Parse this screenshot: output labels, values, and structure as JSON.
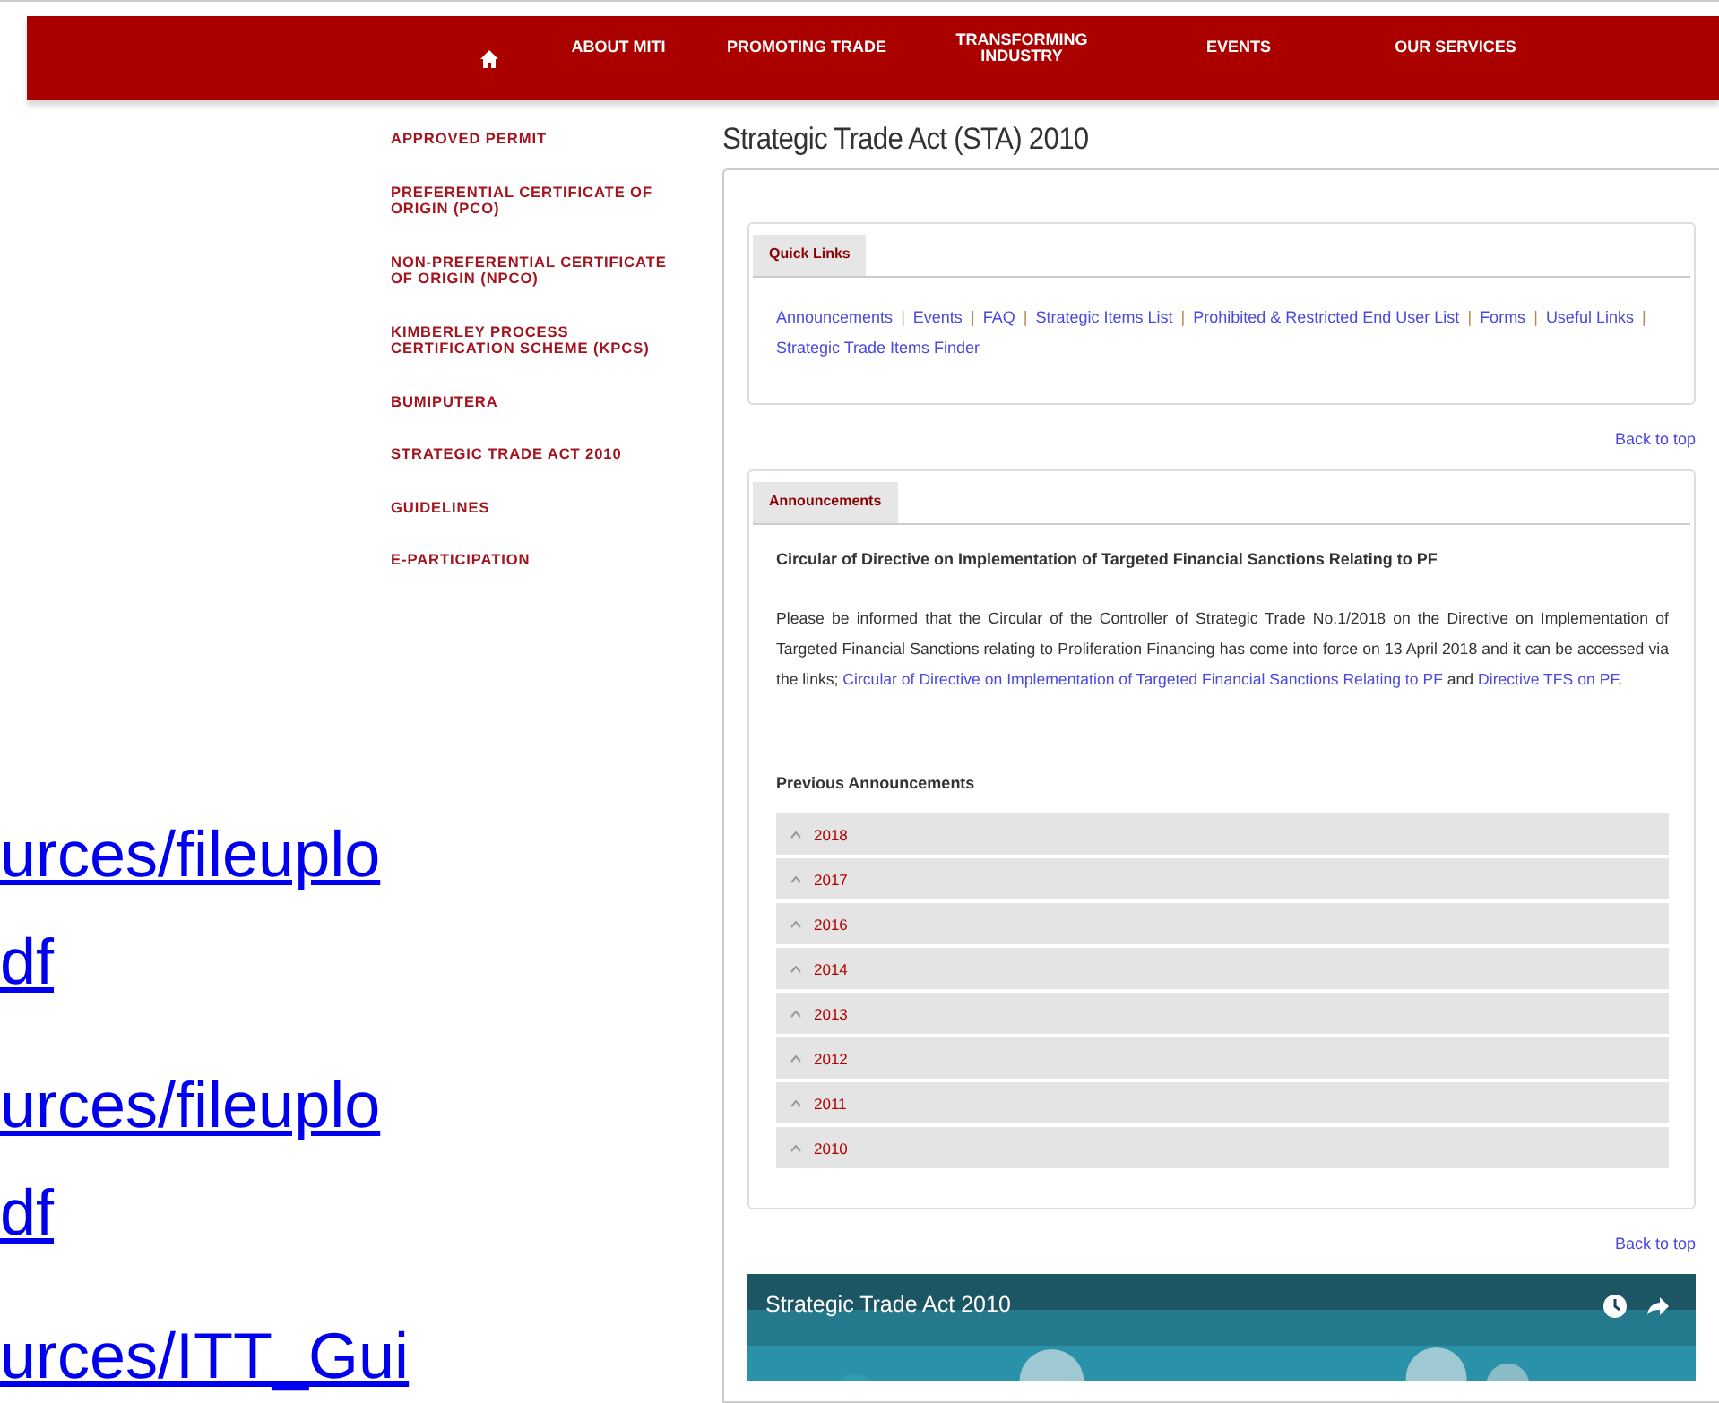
{
  "nav": {
    "items": [
      "ABOUT MITI",
      "PROMOTING TRADE",
      "TRANSFORMING INDUSTRY",
      "EVENTS",
      "OUR SERVICES"
    ]
  },
  "sidebar": {
    "items": [
      "APPROVED PERMIT",
      "PREFERENTIAL CERTIFICATE OF ORIGIN (PCO)",
      "NON-PREFERENTIAL CERTIFICATE OF ORIGIN (NPCO)",
      "KIMBERLEY PROCESS CERTIFICATION SCHEME (KPCS)",
      "BUMIPUTERA",
      "STRATEGIC TRADE ACT 2010",
      "GUIDELINES",
      "E-PARTICIPATION"
    ]
  },
  "page_title": "Strategic Trade Act (STA) 2010",
  "quick_links": {
    "tab": "Quick Links",
    "separator": "|",
    "links": [
      "Announcements",
      "Events",
      "FAQ",
      "Strategic Items List",
      "Prohibited & Restricted End User List",
      "Forms",
      "Useful Links",
      "Strategic Trade Items Finder"
    ],
    "back_link": "Back to top"
  },
  "announcements": {
    "tab": "Announcements",
    "heading": "Circular of Directive on Implementation of Targeted Financial Sanctions Relating to PF",
    "body": [
      {
        "kind": "text",
        "text": "Please be informed that the Circular of the Controller of Strategic Trade No.1/2018 on the Directive on Implementation of Targeted Financial Sanctions relating to Proliferation Financing has come into force on 13 April 2018 and it can be accessed via the links; "
      },
      {
        "kind": "link",
        "text": "Circular of Directive on Implementation of Targeted Financial Sanctions Relating to PF"
      },
      {
        "kind": "text",
        "text": " and "
      },
      {
        "kind": "link",
        "text": "Directive TFS on PF"
      },
      {
        "kind": "text",
        "text": "."
      }
    ],
    "previous_heading": "Previous Announcements",
    "years": [
      {
        "label": "2018",
        "expanded": false
      },
      {
        "label": "2017",
        "expanded": false
      },
      {
        "label": "2016",
        "expanded": false
      },
      {
        "label": "2014",
        "expanded": false
      },
      {
        "label": "2013",
        "expanded": false
      },
      {
        "label": "2012",
        "expanded": false
      },
      {
        "label": "2011",
        "expanded": false
      },
      {
        "label": "2010",
        "expanded": false
      }
    ],
    "back_link": "Back to top"
  },
  "video": {
    "title": "Strategic Trade Act 2010"
  },
  "slide_links": [
    "urces/fileuplo",
    "df",
    "urces/fileuplo",
    "df",
    "urces/ITT_Gui"
  ]
}
